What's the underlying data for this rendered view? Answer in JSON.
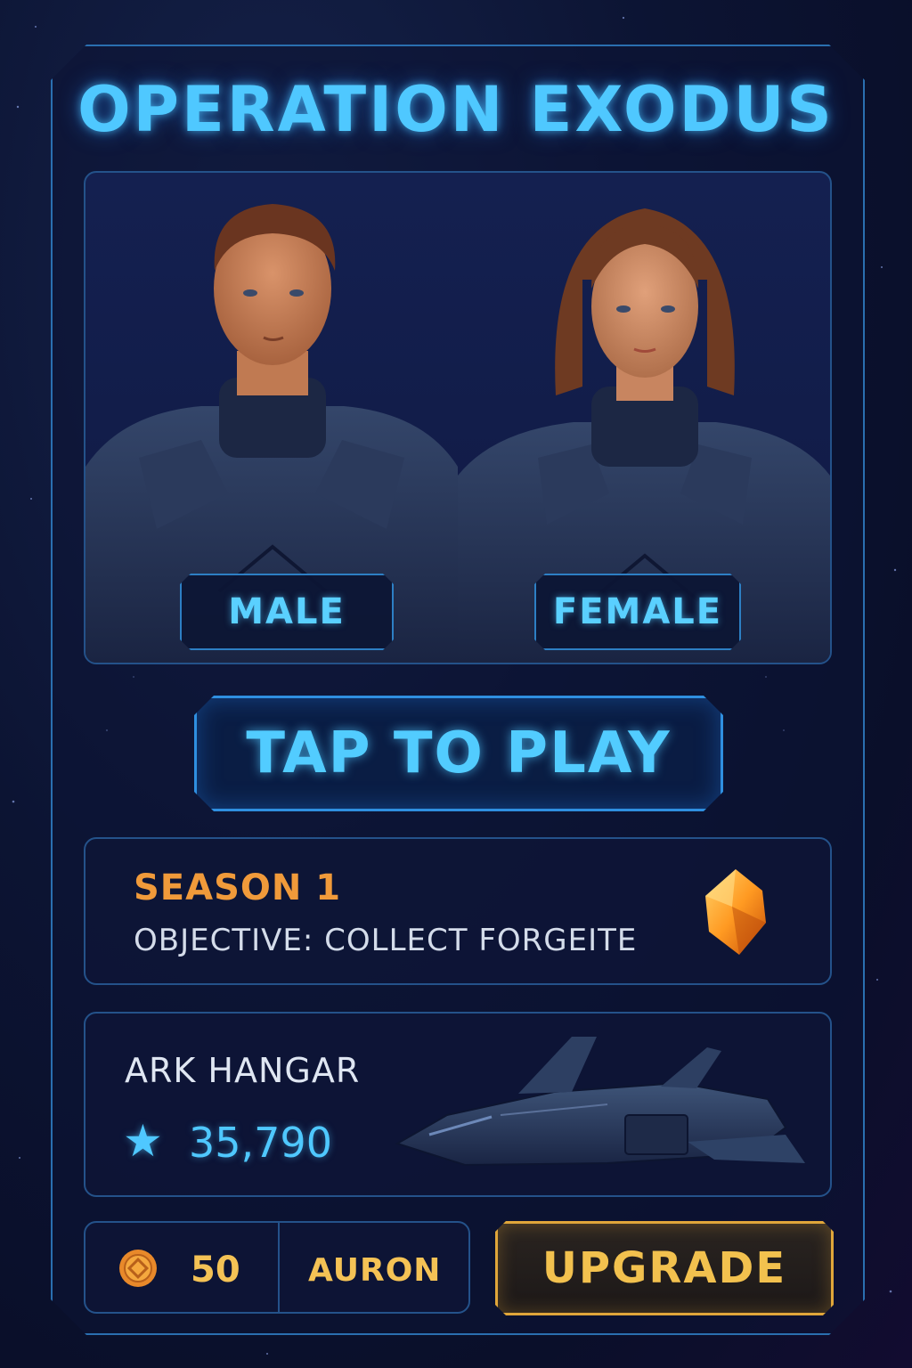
{
  "game": {
    "title": "OPERATION EXODUS"
  },
  "character_select": {
    "options": [
      {
        "label": "MALE"
      },
      {
        "label": "FEMALE"
      }
    ]
  },
  "play_button": {
    "label": "TAP TO PLAY"
  },
  "season": {
    "title": "SEASON 1",
    "objective": "OBJECTIVE: COLLECT FORGEITE",
    "icon": "forgeite-gem-icon"
  },
  "hangar": {
    "title": "ARK HANGAR",
    "score": "35,790",
    "icon": "star-icon"
  },
  "currency": {
    "amount": "50",
    "name": "AURON",
    "icon": "auron-coin-icon"
  },
  "upgrade_button": {
    "label": "UPGRADE"
  },
  "colors": {
    "accent": "#4fc8ff",
    "season": "#f09a3a",
    "gold": "#f2c14e",
    "background": "#0c1433"
  }
}
